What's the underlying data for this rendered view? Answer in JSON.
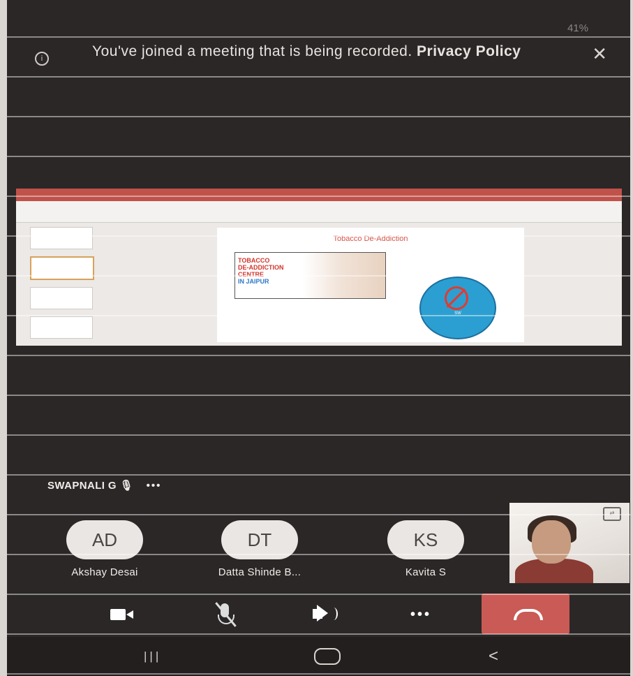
{
  "status_bar": {
    "battery": "41%"
  },
  "notice": {
    "message": "You've joined a meeting that is being recorded.",
    "link": "Privacy Policy",
    "info_icon": "info-icon",
    "close_icon": "close-icon"
  },
  "shared_screen": {
    "slide_title": "Tobacco De-Addiction",
    "banner_lines": [
      "TOBACCO",
      "DE-ADDICTION",
      "CENTRE"
    ],
    "banner_highlight": "IN JAIPUR",
    "badge_mark": "SW"
  },
  "speaker": {
    "name": "SWAPNALI G",
    "more": "•••"
  },
  "participants": [
    {
      "initials": "AD",
      "name": "Akshay Desai"
    },
    {
      "initials": "DT",
      "name": "Datta Shinde B..."
    },
    {
      "initials": "KS",
      "name": "Kavita S"
    }
  ],
  "controls": {
    "camera_icon": "video-camera-icon",
    "mic_icon": "mic-muted-icon",
    "speaker_icon": "speaker-icon",
    "more_label": "•••",
    "end_call_icon": "end-call-icon"
  },
  "nav_bar": {
    "recents": "|||",
    "back": "<"
  },
  "colors": {
    "background": "#2b2727",
    "end_call": "#c95a55",
    "slide_title": "#d6564b"
  }
}
